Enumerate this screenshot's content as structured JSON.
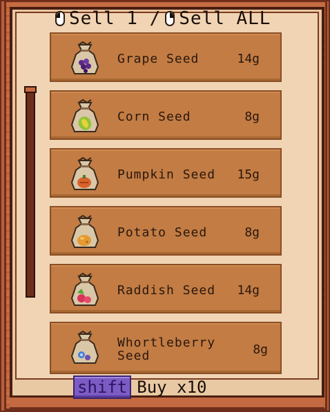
{
  "header": {
    "sell_one": "Sell 1 /",
    "sell_all": "Sell ALL"
  },
  "items": [
    {
      "name": "Grape Seed",
      "price": "14g",
      "icon": "grape-seed-bag-icon",
      "accent": "#5b2a86"
    },
    {
      "name": "Corn Seed",
      "price": "8g",
      "icon": "corn-seed-bag-icon",
      "accent": "#8fc43a"
    },
    {
      "name": "Pumpkin Seed",
      "price": "15g",
      "icon": "pumpkin-seed-bag-icon",
      "accent": "#d9622a"
    },
    {
      "name": "Potato Seed",
      "price": "8g",
      "icon": "potato-seed-bag-icon",
      "accent": "#e59a32"
    },
    {
      "name": "Raddish Seed",
      "price": "14g",
      "icon": "raddish-seed-bag-icon",
      "accent": "#d8355c"
    },
    {
      "name": "Whortleberry Seed",
      "price": "8g",
      "icon": "whortleberry-seed-bag-icon",
      "accent": "#4a7fd8"
    }
  ],
  "footer": {
    "shift_label": "shift",
    "buy_label": "Buy x10"
  },
  "colors": {
    "frame": "#b85a3a",
    "panel": "#f0d4b4",
    "item_bg": "#c27c44",
    "shift_key": "#7c5bc4"
  }
}
